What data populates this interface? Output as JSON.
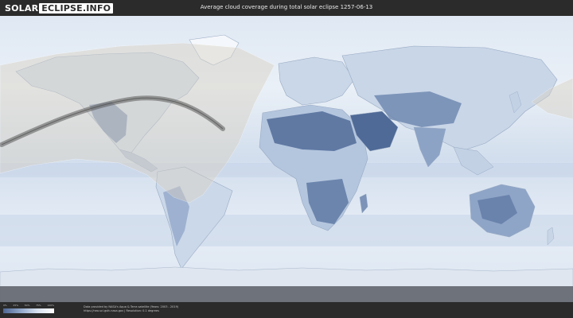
{
  "header": {
    "logo_left": "SOLAR",
    "logo_right": "ECLIPSE.INFO",
    "title": "Average cloud coverage during total solar eclipse 1257-06-13"
  },
  "legend": {
    "ticks": [
      "0%",
      "25%",
      "50%",
      "75%",
      "100%"
    ],
    "colors": [
      "#4e6794",
      "#8fa6c8",
      "#d6e1ef",
      "#ffffff"
    ]
  },
  "footer": {
    "credit_line1": "Data provided by NASA's Aqua & Terra satellite (Years: 2003 - 2019)",
    "credit_line2": "https://neo.sci.gsfc.nasa.gov | Resolution: 0.1 degrees"
  },
  "map": {
    "ocean_color": "#e4ecf5",
    "land_cloudy_color": "#c6d3e5",
    "clear_sky_color": "#5f7aa6",
    "visibility_zone_color": "#d9d2c4",
    "eclipse_path_color": "#5a5a5a"
  }
}
